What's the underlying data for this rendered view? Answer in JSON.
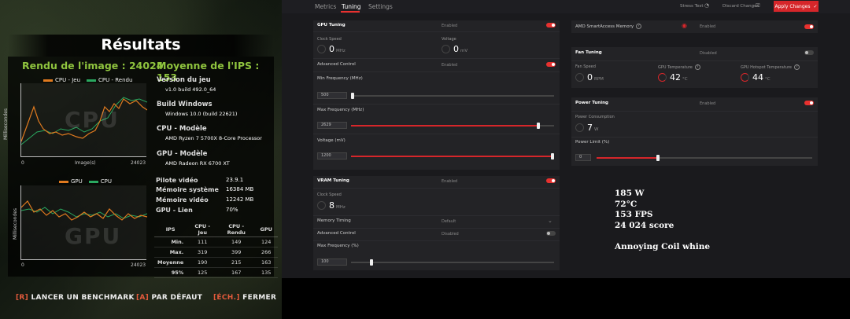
{
  "bench": {
    "title": "Résultats",
    "rendu_image": "Rendu de l'image : 24024",
    "moyenne_ips": "Moyenne de l'IPS : 153",
    "chart1": {
      "legend_cpu_jeu": "CPU - Jeu",
      "legend_cpu_rendu": "CPU - Rendu",
      "ylabel": "Millisecondes",
      "xlabel": "Image(s)",
      "x_start": "0",
      "x_end": "24023",
      "watermark": "CPU",
      "color_cpu_jeu": "#e07a1f",
      "color_cpu_rendu": "#2aa860"
    },
    "chart2": {
      "legend_gpu": "GPU",
      "legend_cpu": "CPU",
      "ylabel": "Millisecondes",
      "x_start": "0",
      "x_end": "24023",
      "watermark": "GPU",
      "color_gpu": "#e07a1f",
      "color_cpu": "#2aa860"
    },
    "system": [
      {
        "label": "Version du jeu",
        "value": "v1.0 build 492.0_64"
      },
      {
        "label": "Build Windows",
        "value": "Windows 10.0 (build 22621)"
      },
      {
        "label": "CPU - Modèle",
        "value": "AMD Ryzen 7 5700X 8-Core Processor"
      },
      {
        "label": "GPU - Modèle",
        "value": "AMD Radeon RX 6700 XT"
      }
    ],
    "info": [
      {
        "label": "Pilote vidéo",
        "value": "23.9.1"
      },
      {
        "label": "Mémoire système",
        "value": "16384 MB"
      },
      {
        "label": "Mémoire vidéo",
        "value": "12242 MB"
      },
      {
        "label": "GPU - Lien",
        "value": "70%"
      }
    ],
    "ips_table": {
      "headers": [
        "IPS",
        "CPU - Jeu",
        "CPU - Rendu",
        "GPU"
      ],
      "rows": [
        [
          "Min.",
          "111",
          "149",
          "124"
        ],
        [
          "Max.",
          "319",
          "399",
          "266"
        ],
        [
          "Moyenne",
          "190",
          "215",
          "163"
        ],
        [
          "95%",
          "125",
          "167",
          "135"
        ]
      ]
    },
    "buttons": [
      {
        "key": "[R]",
        "label": "LANCER UN BENCHMARK"
      },
      {
        "key": "[A]",
        "label": "PAR DÉFAUT"
      },
      {
        "key": "[ÉCH.]",
        "label": "FERMER"
      }
    ]
  },
  "tuner": {
    "tabs": [
      "Metrics",
      "Tuning",
      "Settings"
    ],
    "active_tab": "Tuning",
    "stress_test": "Stress Test",
    "discard_changes": "Discard Changes",
    "apply_changes": "Apply Changes",
    "accent": "#d6262a",
    "gpu_tuning": {
      "title": "GPU Tuning",
      "status": "Enabled",
      "clock_speed_label": "Clock Speed",
      "clock_speed_value": "0",
      "clock_speed_unit": "MHz",
      "voltage_label": "Voltage",
      "voltage_value": "0",
      "voltage_unit": "mV",
      "advanced_control_label": "Advanced Control",
      "advanced_control_status": "Enabled",
      "min_freq_label": "Min Frequency (MHz)",
      "min_freq_value": "500",
      "max_freq_label": "Max Frequency (MHz)",
      "max_freq_value": "2629",
      "voltage_mv_label": "Voltage (mV)",
      "voltage_mv_value": "1200"
    },
    "vram_tuning": {
      "title": "VRAM Tuning",
      "status": "Enabled",
      "clock_speed_label": "Clock Speed",
      "clock_speed_value": "8",
      "clock_speed_unit": "MHz",
      "memory_timing_label": "Memory Timing",
      "memory_timing_value": "Default",
      "advanced_control_label": "Advanced Control",
      "advanced_control_status": "Disabled",
      "max_freq_label": "Max Frequency (%)",
      "max_freq_value": "100"
    },
    "sam": {
      "title": "AMD SmartAccess Memory",
      "status": "Enabled"
    },
    "fan_tuning": {
      "title": "Fan Tuning",
      "status": "Disabled",
      "fan_speed_label": "Fan Speed",
      "fan_speed_value": "0",
      "fan_speed_unit": "RPM",
      "gpu_temp_label": "GPU Temperature",
      "gpu_temp_value": "42",
      "gpu_temp_unit": "°C",
      "hotspot_label": "GPU Hotspot Temperature",
      "hotspot_value": "44",
      "hotspot_unit": "°C"
    },
    "power_tuning": {
      "title": "Power Tuning",
      "status": "Enabled",
      "power_label": "Power Consumption",
      "power_value": "7",
      "power_unit": "W",
      "limit_label": "Power Limit (%)",
      "limit_value": "0"
    }
  },
  "notes": [
    "185 W",
    "72°C",
    "153 FPS",
    "24 024 score",
    "Annoying Coil whine"
  ]
}
